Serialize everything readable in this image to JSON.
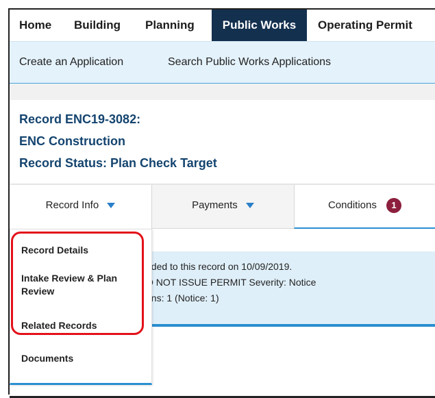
{
  "topnav": {
    "items": [
      "Home",
      "Building",
      "Planning",
      "Public Works",
      "Operating Permit"
    ],
    "active": "Public Works"
  },
  "subnav": {
    "items": [
      "Create an Application",
      "Search Public Works Applications"
    ]
  },
  "record": {
    "id_line": "Record ENC19-3082:",
    "type_line": "ENC Construction",
    "status_line": "Record Status: Plan Check Target"
  },
  "tabs": {
    "record_info": "Record Info",
    "payments": "Payments",
    "conditions": "Conditions",
    "conditions_count": "1"
  },
  "notice": {
    "line1": "dded to this record on 10/09/2019.",
    "line2": "O NOT ISSUE PERMIT   Severity: Notice",
    "line3": "ons: 1  (Notice: 1)"
  },
  "dropdown": {
    "items": [
      "Record Details",
      "Intake Review & Plan Review",
      "Related Records",
      "Documents"
    ]
  },
  "colors": {
    "nav_active": "#14304f",
    "record_text": "#14446f",
    "accent_blue": "#2a8fd0",
    "badge": "#8c1f3d",
    "highlight": "#e3101a"
  }
}
